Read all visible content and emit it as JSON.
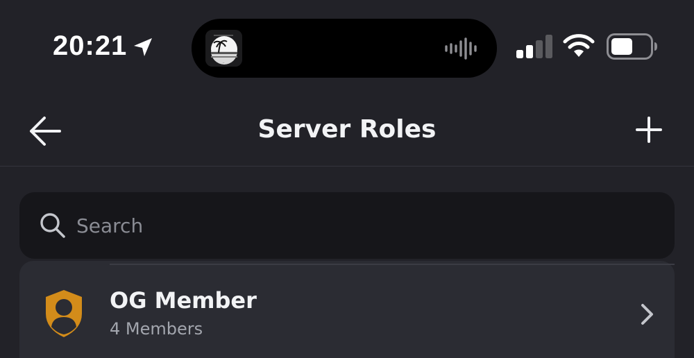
{
  "status_bar": {
    "time": "20:21",
    "icons": [
      "location-arrow-icon",
      "now-playing-artwork",
      "audio-waveform-icon",
      "cellular-signal-icon",
      "wifi-icon",
      "battery-icon"
    ]
  },
  "nav": {
    "title": "Server Roles",
    "back_icon": "arrow-left-icon",
    "add_icon": "plus-icon"
  },
  "search": {
    "placeholder": "Search",
    "value": "",
    "icon": "search-icon"
  },
  "roles": [
    {
      "name": "OG Member",
      "members": "4 Members",
      "icon": "shield-person-icon",
      "color": "#d38c1a"
    }
  ],
  "colors": {
    "background": "#222228",
    "search_bg": "#16161a",
    "row_bg": "#2b2c33",
    "role_color": "#d38c1a"
  }
}
